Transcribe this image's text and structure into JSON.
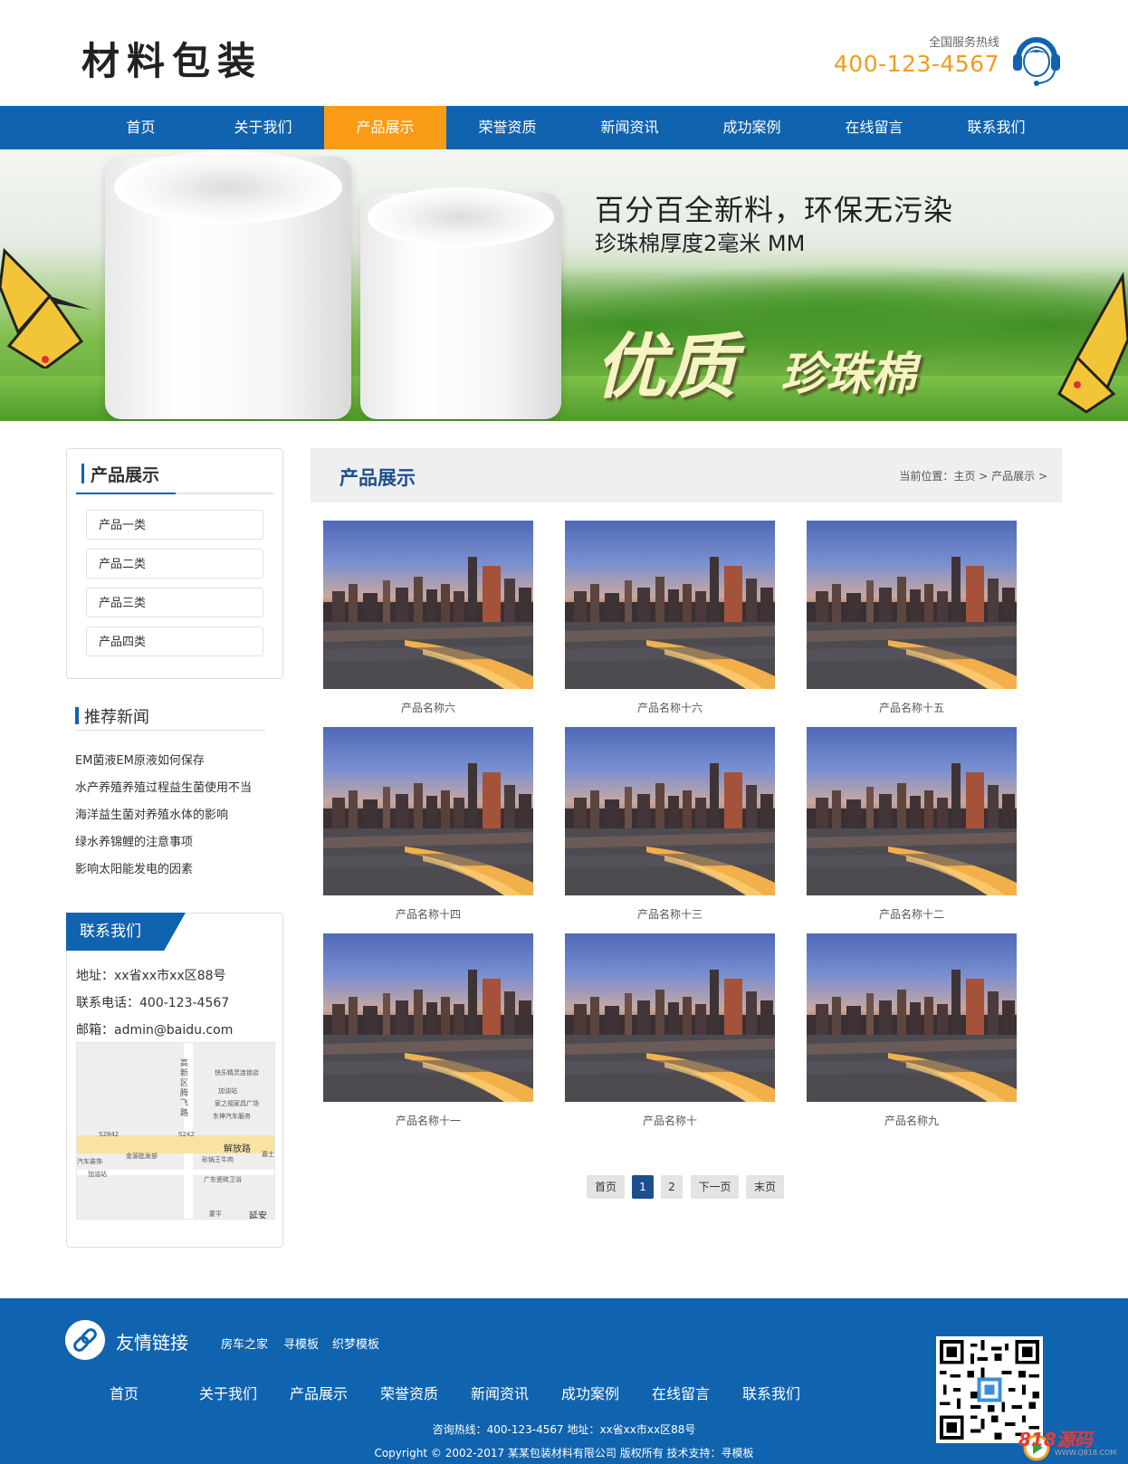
{
  "header": {
    "logo": "材料包装",
    "hotline_label": "全国服务热线",
    "hotline_number": "400-123-4567"
  },
  "nav": {
    "items": [
      "首页",
      "关于我们",
      "产品展示",
      "荣誉资质",
      "新闻资讯",
      "成功案例",
      "在线留言",
      "联系我们"
    ],
    "active_index": 2,
    "active_color": "#fa9b17",
    "bar_color": "#1063ae"
  },
  "banner": {
    "line1": "百分百全新料，环保无污染",
    "line2": "珍珠棉厚度2毫米 MM",
    "big1": "优质",
    "big2": "珍珠棉"
  },
  "sidebar": {
    "products_title": "产品展示",
    "categories": [
      "产品一类",
      "产品二类",
      "产品三类",
      "产品四类"
    ],
    "news_title": "推荐新闻",
    "news": [
      "EM菌液EM原液如何保存",
      "水产养殖养殖过程益生菌使用不当",
      "海洋益生菌对养殖水体的影响",
      "绿水养锦鲤的注意事项",
      "影响太阳能发电的因素"
    ],
    "contact_title": "联系我们",
    "contact": {
      "address": "地址：xx省xx市xx区88号",
      "phone": "联系电话：400-123-4567",
      "email": "邮箱：admin@baidu.com"
    },
    "map_labels": {
      "road_v": "高新区腾飞路",
      "l1": "快乐精灵连锁店",
      "l2": "加油站",
      "l3": "家之福家具广场",
      "l4": "东神汽车服务",
      "l5": "解放路",
      "l6": "金源批发部",
      "l7": "砂锅王牛肉",
      "l8": "广东瓷砖卫浴",
      "l9": "汽车装饰",
      "l10": "加油站",
      "l11": "嘉士",
      "l12": "蒙平",
      "l13": "延安",
      "l14": "S2842",
      "l15": "S242"
    }
  },
  "main": {
    "title": "产品展示",
    "breadcrumb": {
      "prefix": "当前位置：",
      "home": "主页",
      "sep1": ">",
      "current": "产品展示",
      "sep2": ">"
    },
    "products": [
      "产品名称六",
      "产品名称十六",
      "产品名称十五",
      "产品名称十四",
      "产品名称十三",
      "产品名称十二",
      "产品名称十一",
      "产品名称十",
      "产品名称九"
    ],
    "pagination": {
      "first": "首页",
      "pages": [
        "1",
        "2"
      ],
      "current": "1",
      "next": "下一页",
      "last": "末页"
    }
  },
  "footer": {
    "links_title": "友情链接",
    "links": [
      "房车之家",
      "寻模板",
      "织梦模板"
    ],
    "nav": [
      "首页",
      "关于我们",
      "产品展示",
      "荣誉资质",
      "新闻资讯",
      "成功案例",
      "在线留言",
      "联系我们"
    ],
    "info": "咨询热线：400-123-4567 地址：xx省xx市xx区88号",
    "copyright": "Copyright © 2002-2017 某某包装材料有限公司 版权所有 技术支持：寻模板"
  },
  "watermark": {
    "main": "818源码",
    "sub": "WWW.Q818.COM"
  }
}
